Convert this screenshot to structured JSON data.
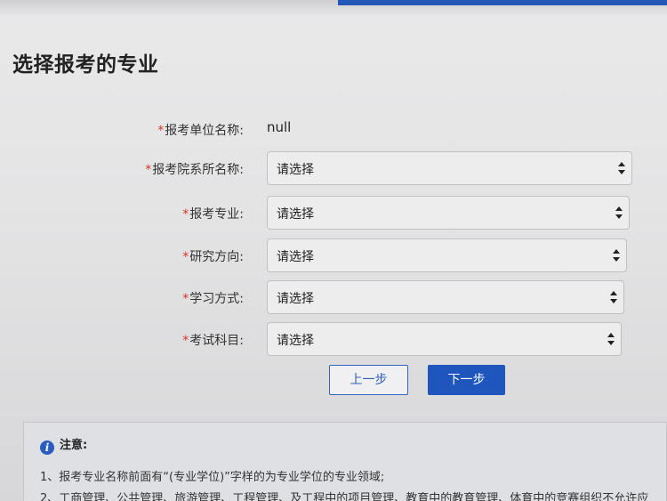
{
  "page": {
    "title": "选择报考的专业"
  },
  "form": {
    "unit": {
      "required_mark": "*",
      "label": "报考单位名称:",
      "value": "null"
    },
    "department": {
      "required_mark": "*",
      "label": "报考院系所名称:",
      "selected": "请选择"
    },
    "major": {
      "required_mark": "*",
      "label": "报考专业:",
      "selected": "请选择"
    },
    "research_direction": {
      "required_mark": "*",
      "label": "研究方向:",
      "selected": "请选择"
    },
    "study_mode": {
      "required_mark": "*",
      "label": "学习方式:",
      "selected": "请选择"
    },
    "exam_subjects": {
      "required_mark": "*",
      "label": "考试科目:",
      "selected": "请选择"
    }
  },
  "buttons": {
    "prev_label": "上一步",
    "next_label": "下一步"
  },
  "notice": {
    "icon": "info-icon",
    "icon_glyph": "i",
    "heading": "注意:",
    "lines": [
      "1、报考专业名称前面有“(专业学位)”字样的为专业学位的专业领域;",
      "2、工商管理、公共管理、旅游管理、工程管理、及工程中的项目管理、教育中的教育管理、体育中的竞赛组织不允许应"
    ]
  },
  "colors": {
    "accent": "#1f56be",
    "required": "#d9342b"
  }
}
